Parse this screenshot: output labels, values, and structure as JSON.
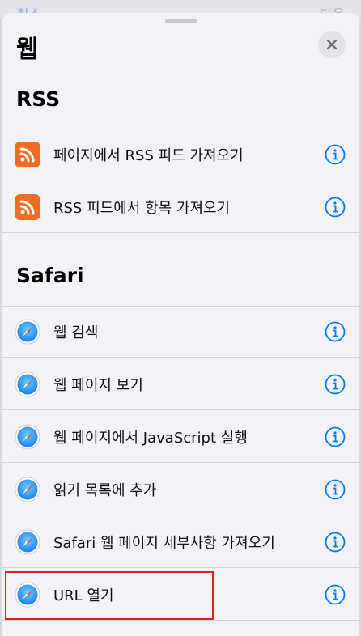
{
  "behind": {
    "left_label": "취소",
    "right_label": "다음"
  },
  "sheet": {
    "title": "웹"
  },
  "sections": [
    {
      "header": "RSS",
      "items": [
        {
          "label": "페이지에서 RSS 피드 가져오기",
          "icon": "rss-icon"
        },
        {
          "label": "RSS 피드에서 항목 가져오기",
          "icon": "rss-icon"
        }
      ]
    },
    {
      "header": "Safari",
      "items": [
        {
          "label": "웹 검색",
          "icon": "safari-compass-icon"
        },
        {
          "label": "웹 페이지 보기",
          "icon": "safari-compass-icon"
        },
        {
          "label": "웹 페이지에서 JavaScript 실행",
          "icon": "safari-compass-icon"
        },
        {
          "label": "읽기 목록에 추가",
          "icon": "safari-compass-icon"
        },
        {
          "label": "Safari 웹 페이지 세부사항 가져오기",
          "icon": "safari-compass-icon"
        },
        {
          "label": "URL 열기",
          "icon": "safari-compass-icon"
        }
      ]
    }
  ],
  "colors": {
    "accent": "#007aff",
    "rss": "#f26b21",
    "highlight": "#e02020"
  }
}
